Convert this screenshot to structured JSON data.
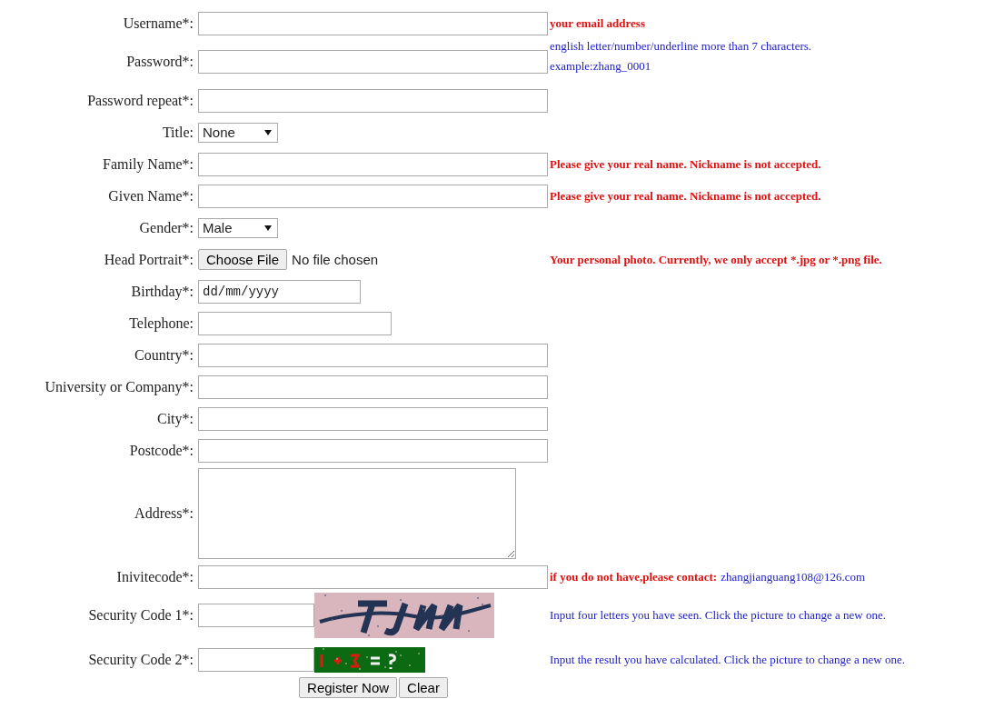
{
  "rows": [
    {
      "label": "Username*:",
      "kind": "text",
      "hint": [
        {
          "text": "your email address",
          "kind": "alert"
        }
      ]
    },
    {
      "label": "Password*:",
      "kind": "text",
      "hint_lines": [
        {
          "text": "english letter/number/underline more than 7 characters.",
          "kind": "info"
        },
        {
          "text": "example:zhang_0001",
          "kind": "info"
        }
      ]
    },
    {
      "label": "Password repeat*:",
      "kind": "text"
    },
    {
      "label": "Title:",
      "kind": "select",
      "value": "None"
    },
    {
      "label": "Family Name*:",
      "kind": "text",
      "hint": [
        {
          "text": "Please give your real name. Nickname is not accepted.",
          "kind": "alert"
        }
      ]
    },
    {
      "label": "Given Name*:",
      "kind": "text",
      "hint": [
        {
          "text": "Please give your real name. Nickname is not accepted.",
          "kind": "alert"
        }
      ]
    },
    {
      "label": "Gender*:",
      "kind": "select",
      "value": "Male"
    },
    {
      "label": "Head Portrait*:",
      "kind": "file",
      "button": "Choose File",
      "status": "No file chosen",
      "hint": [
        {
          "text": "Your personal photo. Currently, we only accept *.jpg or *.png file.",
          "kind": "alert"
        }
      ]
    },
    {
      "label": "Birthday*:",
      "kind": "date",
      "placeholder": "dd/mm/yyyy"
    },
    {
      "label": "Telephone:",
      "kind": "phone"
    },
    {
      "label": "Country*:",
      "kind": "text"
    },
    {
      "label": "University or Company*:",
      "kind": "text"
    },
    {
      "label": "City*:",
      "kind": "text"
    },
    {
      "label": "Postcode*:",
      "kind": "text"
    },
    {
      "label": "Address*:",
      "kind": "textarea"
    },
    {
      "label": "Inivitecode*:",
      "kind": "text",
      "hint": [
        {
          "text": "if you do not have,please contact:",
          "kind": "alert"
        },
        {
          "text": "zhangjianguang108@126.com",
          "kind": "info"
        }
      ]
    },
    {
      "label": "Security Code 1*:",
      "kind": "captcha_letters",
      "hint": [
        {
          "text": "Input four letters you have seen. Click the picture to change a new one.",
          "kind": "info"
        }
      ]
    },
    {
      "label": "Security Code 2*:",
      "kind": "captcha_sum",
      "hint": [
        {
          "text": "Input the result you have calculated. Click the picture to change a new one.",
          "kind": "info"
        }
      ]
    }
  ],
  "buttons": [
    "Register Now",
    "Clear"
  ]
}
